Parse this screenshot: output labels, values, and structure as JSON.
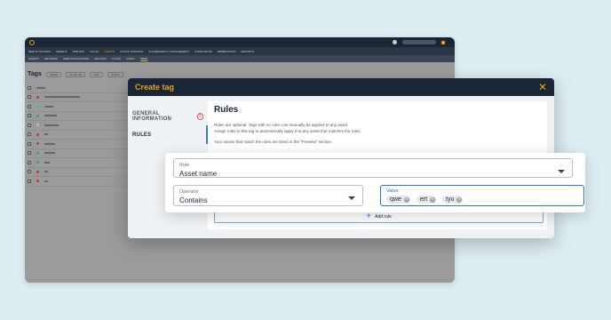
{
  "app": {
    "nav_primary": [
      "NEW IN TENABLE",
      "NESSUS",
      "WEB APP",
      "VULNS",
      "ASSETS",
      "ATTACK SURFACE",
      "VULNERABILITY MANAGEMENT",
      "COMPLIANCE",
      "REMEDIATION",
      "REPORTS"
    ],
    "nav_secondary": [
      "ASSETS",
      "NETWORK",
      "WEB APPLICATIONS",
      "DEVICES",
      "CLOUD",
      "ASSET",
      "TAGS"
    ],
    "page_title": "Tags",
    "toolbar": [
      "Search",
      "Create tag",
      "Filter",
      "Search"
    ]
  },
  "modal": {
    "title": "Create tag",
    "close_icon": "close-icon",
    "steps": [
      {
        "label": "GENERAL INFORMATION",
        "warning": "!"
      },
      {
        "label": "RULES"
      }
    ],
    "section_title": "Rules",
    "description_line1": "Rules are optional. Tags with no rules can manually be applied to any asset.",
    "description_line2": "Assign rules to this tag to automatically apply it to any asset that matches the rules.",
    "description_line3": "Your assets that match the rules are listed in the \"Preview\" section.",
    "add_rule_label": "Add rule"
  },
  "rule": {
    "rule_label": "Rule",
    "rule_value": "Asset name",
    "operator_label": "Operator",
    "operator_value": "Contains",
    "value_label": "Value",
    "values": [
      "qwe",
      "ert",
      "tyu"
    ],
    "chip_remove": "×"
  },
  "colors": {
    "brand": "#e8a317",
    "header": "#1a2535",
    "focus": "#2f6fcf"
  }
}
